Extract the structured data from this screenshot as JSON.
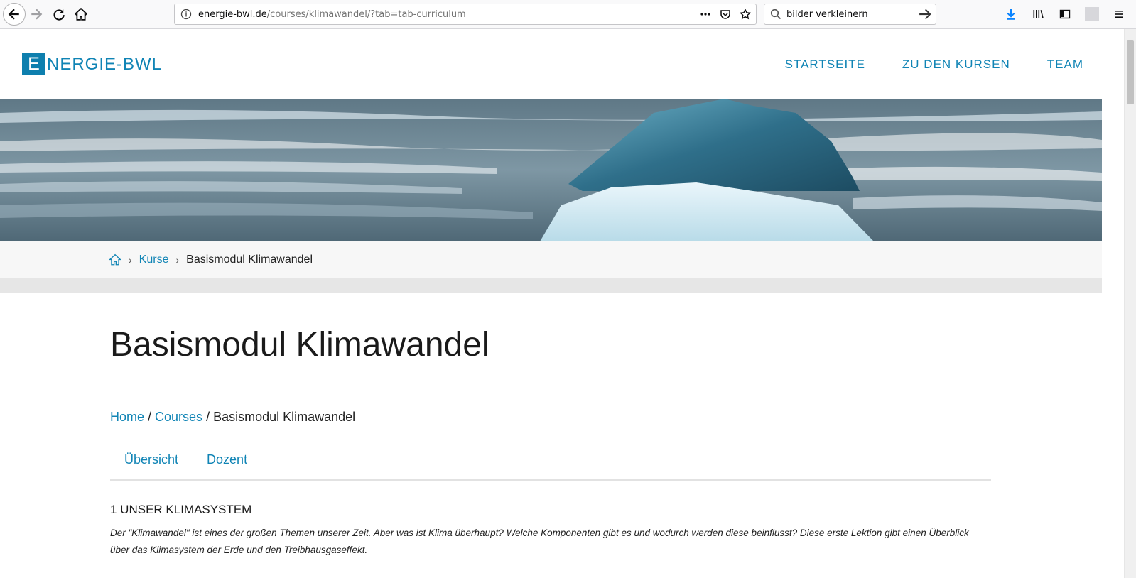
{
  "browser": {
    "url_host": "energie-bwl.de",
    "url_path": "/courses/klimawandel/?tab=tab-curriculum",
    "search_value": "bilder verkleinern"
  },
  "site": {
    "logo_letter": "E",
    "logo_rest": "NERGIE-BWL",
    "nav": [
      "STARTSEITE",
      "ZU DEN KURSEN",
      "TEAM"
    ]
  },
  "breadcrumb": {
    "kurse": "Kurse",
    "current": "Basismodul Klimawandel"
  },
  "main": {
    "title": "Basismodul Klimawandel",
    "crumb_home": "Home",
    "crumb_courses": "Courses",
    "crumb_sep1": " / ",
    "crumb_sep2": " / ",
    "crumb_current": "Basismodul Klimawandel",
    "tabs": [
      "Übersicht",
      "Dozent"
    ],
    "section_title": "1 UNSER KLIMASYSTEM",
    "section_desc": "Der \"Klimawandel\" ist eines der großen Themen unserer Zeit. Aber was ist Klima überhaupt? Welche Komponenten gibt es und wodurch werden diese beinflusst? Diese erste Lektion gibt einen Überblick über das Klimasystem der Erde und den Treibhausgaseffekt."
  },
  "colors": {
    "accent": "#1084b5",
    "logo_box": "#0e7fae",
    "crumb_band": "#f7f7f7"
  }
}
